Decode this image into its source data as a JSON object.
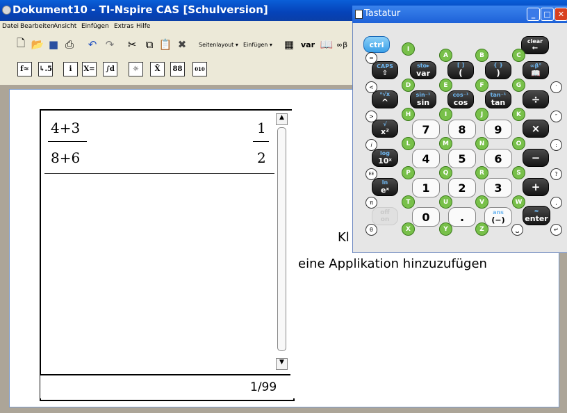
{
  "window": {
    "title": "Dokument10 - TI-Nspire CAS [Schulversion]"
  },
  "menu": [
    "Datei",
    "Bearbeiten",
    "Ansicht",
    "Einfügen",
    "Extras",
    "Hilfe"
  ],
  "toolbar": {
    "layout_label": "Seitenlayout ▾",
    "insert_label": "Einfügen ▾",
    "var_label": "var"
  },
  "math_toolbar": [
    "f≈",
    "↳.5",
    "i",
    "X=",
    "∫d",
    "☼",
    "X̄",
    "88",
    "010"
  ],
  "calc": {
    "numerator_left": "4+3",
    "denominator_left": "8+6",
    "numerator_right": "1",
    "denominator_right": "2",
    "page_indicator": "1/99"
  },
  "empty_pane": {
    "line1": "Kl",
    "line2": "eine Applikation hinzuzufügen"
  },
  "keypad": {
    "title": "Tastatur",
    "ctrl": "ctrl",
    "clear": "clear",
    "caps": "CAPS",
    "sto": "sto▸",
    "var": "var",
    "sin": "sin",
    "cos": "cos",
    "tan": "tan",
    "sin_inv": "sin⁻¹",
    "cos_inv": "cos⁻¹",
    "tan_inv": "tan⁻¹",
    "x2": "x²",
    "ten_x": "10ˣ",
    "e_x": "eˣ",
    "log": "log",
    "ln": "ln",
    "off": "off",
    "on": "on",
    "enter": "enter",
    "ans": "ans",
    "neg": "(−)",
    "digits": [
      "7",
      "8",
      "9",
      "4",
      "5",
      "6",
      "1",
      "2",
      "3",
      "0",
      "."
    ],
    "ops": [
      "×",
      "−",
      "+"
    ],
    "letters": [
      "A",
      "B",
      "C",
      "D",
      "E",
      "F",
      "G",
      "H",
      "I",
      "J",
      "K",
      "L",
      "M",
      "N",
      "O",
      "P",
      "Q",
      "R",
      "S",
      "T",
      "U",
      "V",
      "W",
      "X",
      "Y",
      "Z"
    ]
  }
}
